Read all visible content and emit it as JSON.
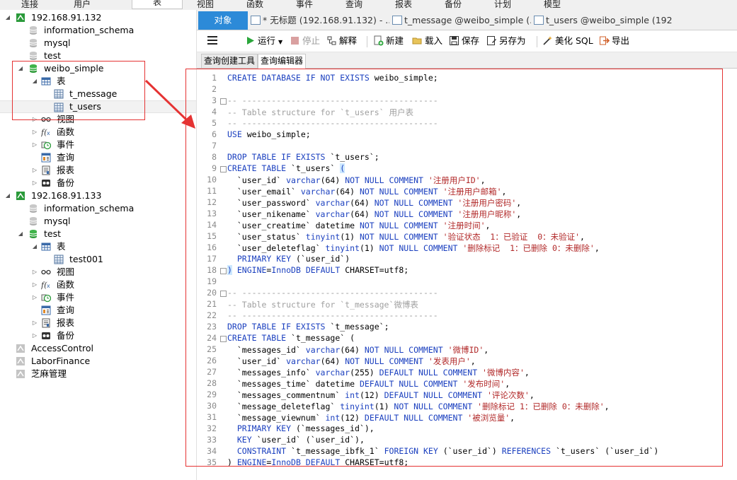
{
  "menubar": {
    "items": [
      "连接",
      "用户",
      "表",
      "视图",
      "函数",
      "事件",
      "查询",
      "报表",
      "备份",
      "计划",
      "模型"
    ],
    "active": 2
  },
  "tree": {
    "nodes": [
      {
        "label": "192.168.91.132",
        "icon": "server-icon",
        "level": 0,
        "expand": "open"
      },
      {
        "label": "information_schema",
        "icon": "database-grey-icon",
        "level": 1,
        "expand": ""
      },
      {
        "label": "mysql",
        "icon": "database-grey-icon",
        "level": 1,
        "expand": ""
      },
      {
        "label": "test",
        "icon": "database-grey-icon",
        "level": 1,
        "expand": ""
      },
      {
        "label": "weibo_simple",
        "icon": "database-green-icon",
        "level": 1,
        "expand": "open"
      },
      {
        "label": "表",
        "icon": "table-folder-icon",
        "level": 2,
        "expand": "open"
      },
      {
        "label": "t_message",
        "icon": "table-icon",
        "level": 3,
        "expand": ""
      },
      {
        "label": "t_users",
        "icon": "table-icon",
        "level": 3,
        "expand": "",
        "selected": true
      },
      {
        "label": "视图",
        "icon": "view-icon",
        "level": 2,
        "expand": "closed"
      },
      {
        "label": "函数",
        "icon": "function-icon",
        "level": 2,
        "expand": "closed"
      },
      {
        "label": "事件",
        "icon": "event-icon",
        "level": 2,
        "expand": "closed"
      },
      {
        "label": "查询",
        "icon": "query-icon",
        "level": 2,
        "expand": ""
      },
      {
        "label": "报表",
        "icon": "report-icon",
        "level": 2,
        "expand": "closed"
      },
      {
        "label": "备份",
        "icon": "backup-icon",
        "level": 2,
        "expand": "closed"
      },
      {
        "label": "192.168.91.133",
        "icon": "server-icon",
        "level": 0,
        "expand": "open"
      },
      {
        "label": "information_schema",
        "icon": "database-grey-icon",
        "level": 1,
        "expand": ""
      },
      {
        "label": "mysql",
        "icon": "database-grey-icon",
        "level": 1,
        "expand": ""
      },
      {
        "label": "test",
        "icon": "database-green-icon",
        "level": 1,
        "expand": "open"
      },
      {
        "label": "表",
        "icon": "table-folder-icon",
        "level": 2,
        "expand": "open"
      },
      {
        "label": "test001",
        "icon": "table-icon",
        "level": 3,
        "expand": ""
      },
      {
        "label": "视图",
        "icon": "view-icon",
        "level": 2,
        "expand": "closed"
      },
      {
        "label": "函数",
        "icon": "function-icon",
        "level": 2,
        "expand": "closed"
      },
      {
        "label": "事件",
        "icon": "event-icon",
        "level": 2,
        "expand": "closed"
      },
      {
        "label": "查询",
        "icon": "query-icon",
        "level": 2,
        "expand": ""
      },
      {
        "label": "报表",
        "icon": "report-icon",
        "level": 2,
        "expand": "closed"
      },
      {
        "label": "备份",
        "icon": "backup-icon",
        "level": 2,
        "expand": "closed"
      },
      {
        "label": "AccessControl",
        "icon": "connection-icon",
        "level": 0,
        "expand": ""
      },
      {
        "label": "LaborFinance",
        "icon": "connection-icon",
        "level": 0,
        "expand": ""
      },
      {
        "label": "芝麻管理",
        "icon": "connection-icon",
        "level": 0,
        "expand": ""
      }
    ]
  },
  "tabs": [
    {
      "label": "对象"
    },
    {
      "label": "* 无标题 (192.168.91.132) - ..."
    },
    {
      "label": "t_message @weibo_simple (..."
    },
    {
      "label": "t_users @weibo_simple (192..."
    }
  ],
  "toolbar": {
    "run": "运行",
    "stop": "停止",
    "explain": "解释",
    "new": "新建",
    "load": "载入",
    "save": "保存",
    "save_as": "另存为",
    "beautify": "美化 SQL",
    "export": "导出"
  },
  "subtabs": [
    "查询创建工具",
    "查询编辑器"
  ],
  "colors": {
    "keyword": "#1a3fbf",
    "string": "#b22a2a",
    "comment": "#a0a0a0",
    "accent": "#2c8ad8",
    "annotation": "#e53333"
  },
  "editor": {
    "lines": [
      [
        [
          "k",
          "CREATE DATABASE IF NOT EXISTS "
        ],
        [
          "t",
          "weibo_simple;"
        ]
      ],
      [],
      [
        [
          "c",
          "-- ----------------------------------------"
        ]
      ],
      [
        [
          "c",
          "-- Table structure for `t_users` 用户表"
        ]
      ],
      [
        [
          "c",
          "-- ----------------------------------------"
        ]
      ],
      [
        [
          "k",
          "USE "
        ],
        [
          "t",
          "weibo_simple;"
        ]
      ],
      [],
      [
        [
          "k",
          "DROP TABLE IF EXISTS "
        ],
        [
          "t",
          "`t_users`;"
        ]
      ],
      [
        [
          "k",
          "CREATE TABLE "
        ],
        [
          "t",
          "`t_users` "
        ],
        [
          "p",
          "("
        ]
      ],
      [
        [
          "t",
          "  `user_id` "
        ],
        [
          "k",
          "varchar"
        ],
        [
          "t",
          "(64) "
        ],
        [
          "k",
          "NOT NULL COMMENT "
        ],
        [
          "s",
          "'注册用户ID'"
        ],
        [
          "t",
          ","
        ]
      ],
      [
        [
          "t",
          "  `user_email` "
        ],
        [
          "k",
          "varchar"
        ],
        [
          "t",
          "(64) "
        ],
        [
          "k",
          "NOT NULL COMMENT "
        ],
        [
          "s",
          "'注册用户邮箱'"
        ],
        [
          "t",
          ","
        ]
      ],
      [
        [
          "t",
          "  `user_password` "
        ],
        [
          "k",
          "varchar"
        ],
        [
          "t",
          "(64) "
        ],
        [
          "k",
          "NOT NULL COMMENT "
        ],
        [
          "s",
          "'注册用户密码'"
        ],
        [
          "t",
          ","
        ]
      ],
      [
        [
          "t",
          "  `user_nikename` "
        ],
        [
          "k",
          "varchar"
        ],
        [
          "t",
          "(64) "
        ],
        [
          "k",
          "NOT NULL COMMENT "
        ],
        [
          "s",
          "'注册用户昵称'"
        ],
        [
          "t",
          ","
        ]
      ],
      [
        [
          "t",
          "  `user_creatime` datetime "
        ],
        [
          "k",
          "NOT NULL COMMENT "
        ],
        [
          "s",
          "'注册时间'"
        ],
        [
          "t",
          ","
        ]
      ],
      [
        [
          "t",
          "  `user_status` "
        ],
        [
          "k",
          "tinyint"
        ],
        [
          "t",
          "(1) "
        ],
        [
          "k",
          "NOT NULL COMMENT "
        ],
        [
          "s",
          "'验证状态  1：已验证  0：未验证'"
        ],
        [
          "t",
          ","
        ]
      ],
      [
        [
          "t",
          "  `user_deleteflag` "
        ],
        [
          "k",
          "tinyint"
        ],
        [
          "t",
          "(1) "
        ],
        [
          "k",
          "NOT NULL COMMENT "
        ],
        [
          "s",
          "'删除标记  1：已删除 0：未删除'"
        ],
        [
          "t",
          ","
        ]
      ],
      [
        [
          "t",
          "  "
        ],
        [
          "k",
          "PRIMARY KEY "
        ],
        [
          "t",
          "(`user_id`)"
        ]
      ],
      [
        [
          "p",
          ")"
        ],
        [
          "t",
          " "
        ],
        [
          "k",
          "ENGINE"
        ],
        [
          "t",
          "="
        ],
        [
          "k",
          "InnoDB DEFAULT "
        ],
        [
          "t",
          "CHARSET=utf8;"
        ]
      ],
      [],
      [
        [
          "c",
          "-- ----------------------------------------"
        ]
      ],
      [
        [
          "c",
          "-- Table structure for `t_message`微博表"
        ]
      ],
      [
        [
          "c",
          "-- ----------------------------------------"
        ]
      ],
      [
        [
          "k",
          "DROP TABLE IF EXISTS "
        ],
        [
          "t",
          "`t_message`;"
        ]
      ],
      [
        [
          "k",
          "CREATE TABLE "
        ],
        [
          "t",
          "`t_message` ("
        ]
      ],
      [
        [
          "t",
          "  `messages_id` "
        ],
        [
          "k",
          "varchar"
        ],
        [
          "t",
          "(64) "
        ],
        [
          "k",
          "NOT NULL COMMENT "
        ],
        [
          "s",
          "'微博ID'"
        ],
        [
          "t",
          ","
        ]
      ],
      [
        [
          "t",
          "  `user_id` "
        ],
        [
          "k",
          "varchar"
        ],
        [
          "t",
          "(64) "
        ],
        [
          "k",
          "NOT NULL COMMENT "
        ],
        [
          "s",
          "'发表用户'"
        ],
        [
          "t",
          ","
        ]
      ],
      [
        [
          "t",
          "  `messages_info` "
        ],
        [
          "k",
          "varchar"
        ],
        [
          "t",
          "(255) "
        ],
        [
          "k",
          "DEFAULT NULL COMMENT "
        ],
        [
          "s",
          "'微博内容'"
        ],
        [
          "t",
          ","
        ]
      ],
      [
        [
          "t",
          "  `messages_time` datetime "
        ],
        [
          "k",
          "DEFAULT NULL COMMENT "
        ],
        [
          "s",
          "'发布时间'"
        ],
        [
          "t",
          ","
        ]
      ],
      [
        [
          "t",
          "  `messages_commentnum` "
        ],
        [
          "k",
          "int"
        ],
        [
          "t",
          "(12) "
        ],
        [
          "k",
          "DEFAULT NULL COMMENT "
        ],
        [
          "s",
          "'评论次数'"
        ],
        [
          "t",
          ","
        ]
      ],
      [
        [
          "t",
          "  `message_deleteflag` "
        ],
        [
          "k",
          "tinyint"
        ],
        [
          "t",
          "(1) "
        ],
        [
          "k",
          "NOT NULL COMMENT "
        ],
        [
          "s",
          "'删除标记 1：已删除 0：未删除'"
        ],
        [
          "t",
          ","
        ]
      ],
      [
        [
          "t",
          "  `message_viewnum` "
        ],
        [
          "k",
          "int"
        ],
        [
          "t",
          "(12) "
        ],
        [
          "k",
          "DEFAULT NULL COMMENT "
        ],
        [
          "s",
          "'被浏览量'"
        ],
        [
          "t",
          ","
        ]
      ],
      [
        [
          "t",
          "  "
        ],
        [
          "k",
          "PRIMARY KEY "
        ],
        [
          "t",
          "(`messages_id`),"
        ]
      ],
      [
        [
          "t",
          "  "
        ],
        [
          "k",
          "KEY "
        ],
        [
          "t",
          "`user_id` (`user_id`),"
        ]
      ],
      [
        [
          "t",
          "  "
        ],
        [
          "k",
          "CONSTRAINT "
        ],
        [
          "t",
          "`t_message_ibfk_1` "
        ],
        [
          "k",
          "FOREIGN KEY "
        ],
        [
          "t",
          "(`user_id`) "
        ],
        [
          "k",
          "REFERENCES "
        ],
        [
          "t",
          "`t_users` (`user_id`)"
        ]
      ],
      [
        [
          "t",
          ") "
        ],
        [
          "k",
          "ENGINE"
        ],
        [
          "t",
          "="
        ],
        [
          "k",
          "InnoDB DEFAULT "
        ],
        [
          "t",
          "CHARSET=utf8;"
        ]
      ]
    ],
    "fold_lines": [
      3,
      9,
      18,
      20,
      24
    ]
  }
}
